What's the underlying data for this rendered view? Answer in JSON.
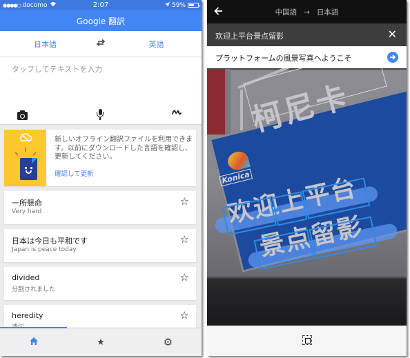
{
  "left_screen": {
    "status_bar": {
      "signal": "●●●●○",
      "carrier": "docomo",
      "wifi_icon": "wifi-icon",
      "time": "2:07",
      "location_icon": "location-arrow-icon",
      "battery_percent": "59%",
      "battery_level": 0.59
    },
    "app_title": "Google 翻訳",
    "language_bar": {
      "source": "日本語",
      "swap_icon": "swap-arrows-icon",
      "target": "英語"
    },
    "input": {
      "placeholder": "タップしてテキストを入力",
      "tools": [
        "camera-icon",
        "microphone-icon",
        "handwriting-icon"
      ]
    },
    "promo_card": {
      "message": "新しいオフライン翻訳ファイルを利用できます。以前にダウンロードした言語を確認し、更新してください。",
      "action": "確認して更新",
      "colors": {
        "art_background": "#fbc92d",
        "document": "#2a3d96"
      }
    },
    "history": [
      {
        "source": "一所懸命",
        "translation": "Very hard",
        "starred": false
      },
      {
        "source": "日本は今日も平和です",
        "translation": "Japan is peace today",
        "starred": false
      },
      {
        "source": "divided",
        "translation": "分割されました",
        "starred": false
      },
      {
        "source": "heredity",
        "translation": "遺伝",
        "starred": false
      }
    ],
    "bottom_nav": {
      "tabs": [
        {
          "name": "home",
          "icon": "home-icon",
          "glyph": "⌂",
          "active": true
        },
        {
          "name": "phrasebook",
          "icon": "star-icon",
          "glyph": "★",
          "active": false
        },
        {
          "name": "settings",
          "icon": "gear-icon",
          "glyph": "⚙",
          "active": false
        }
      ]
    },
    "colors": {
      "primary": "#4285f4",
      "status_bar": "#3d79e0"
    }
  },
  "right_screen": {
    "top_bar": {
      "back_icon": "back-arrow-icon",
      "source_language": "中国語",
      "arrow": "→",
      "target_language": "日本語"
    },
    "detected_text": "欢迎上平台景点留影",
    "close_glyph": "✕",
    "translated_text": "プラットフォームの風景写真へようこそ",
    "go_glyph": "➔",
    "photo_sign": {
      "title": "柯尼卡",
      "brand": "Konica",
      "line1": "欢迎上平台",
      "line2": "景点留影"
    },
    "bottom_toolbar": {
      "icon": "select-all-icon"
    }
  }
}
